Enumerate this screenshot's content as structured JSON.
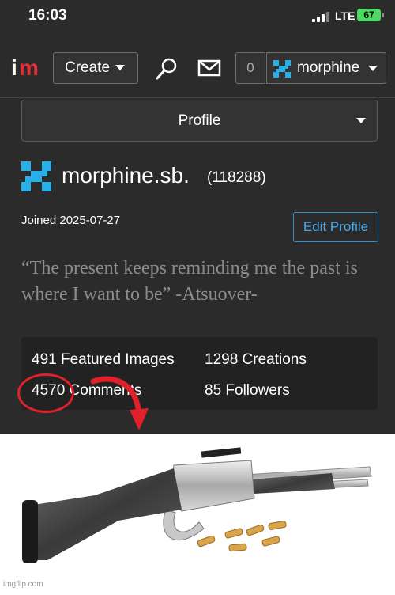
{
  "status": {
    "time": "16:03",
    "network": "LTE",
    "battery": "67"
  },
  "nav": {
    "logo_i": "i",
    "logo_m": "m",
    "create_label": "Create",
    "notifications_count": "0",
    "username": "morphine"
  },
  "profile": {
    "dropdown_label": "Profile",
    "username": "morphine.sb.",
    "points": "(118288)",
    "joined": "Joined 2025-07-27",
    "edit_label": "Edit Profile",
    "bio": "“The present keeps reminding me the past is where I want to be” -Atsuover-"
  },
  "stats": {
    "featured_images": "491 Featured Images",
    "creations": "1298 Creations",
    "comments": "4570 Comments",
    "followers": "85 Followers"
  },
  "annotation": {
    "color": "#e0202a"
  },
  "watermark": "imgflip.com",
  "colors": {
    "background": "#2b2b2b",
    "accent_blue": "#2a8fd6",
    "avatar": "#2ab0e8",
    "logo_red": "#e0303a"
  }
}
